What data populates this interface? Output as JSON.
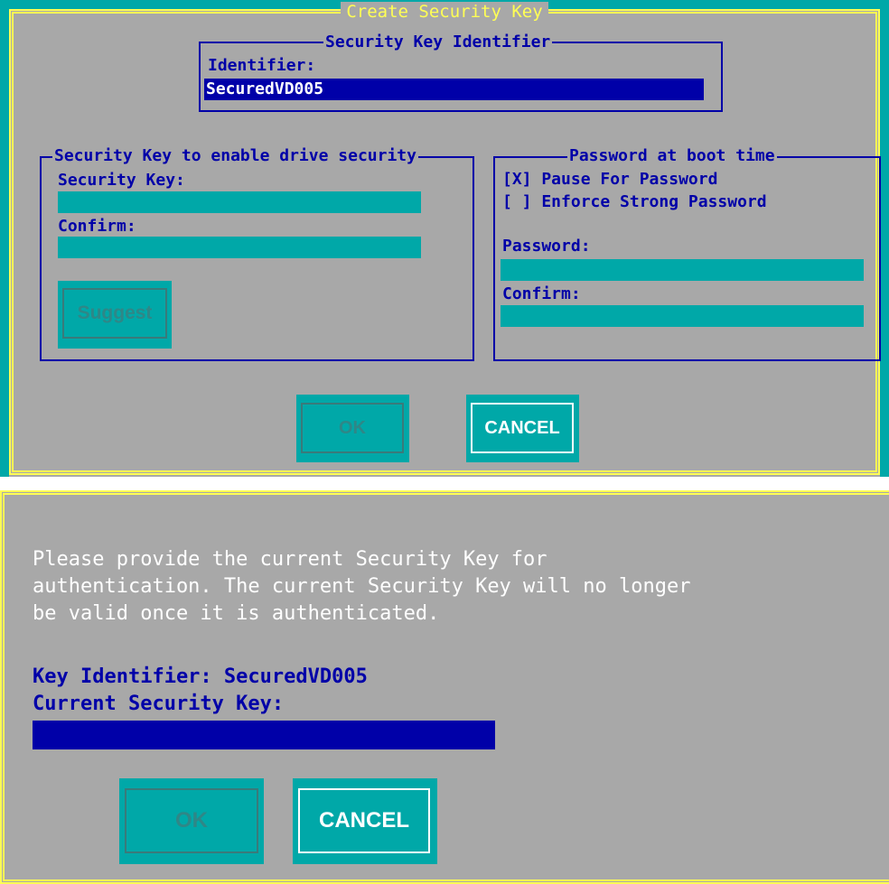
{
  "dialog1": {
    "title": "Create Security Key",
    "identifier_box": {
      "legend": "Security Key Identifier",
      "label": "Identifier:",
      "value": "SecuredVD005"
    },
    "security_key_box": {
      "legend": "Security Key to enable drive security",
      "key_label": "Security Key:",
      "confirm_label": "Confirm:",
      "suggest_button": "Suggest"
    },
    "boot_box": {
      "legend": "Password at boot time",
      "pause_checkbox": "[X] Pause For Password",
      "strong_checkbox": "[ ] Enforce Strong Password",
      "password_label": "Password:",
      "confirm_label": "Confirm:"
    },
    "ok_button": "OK",
    "cancel_button": "CANCEL"
  },
  "dialog2": {
    "message": "Please provide the current Security Key for\nauthentication. The current Security Key will no longer\nbe valid once it is authenticated.",
    "key_identifier_line": "Key Identifier: SecuredVD005",
    "current_key_label": "Current Security Key:",
    "ok_button": "OK",
    "cancel_button": "CANCEL"
  },
  "colors": {
    "dialog_bg": "#a8a8a8",
    "teal": "#00a8a8",
    "navy": "#0000a8",
    "title_yellow": "#ffff54"
  }
}
